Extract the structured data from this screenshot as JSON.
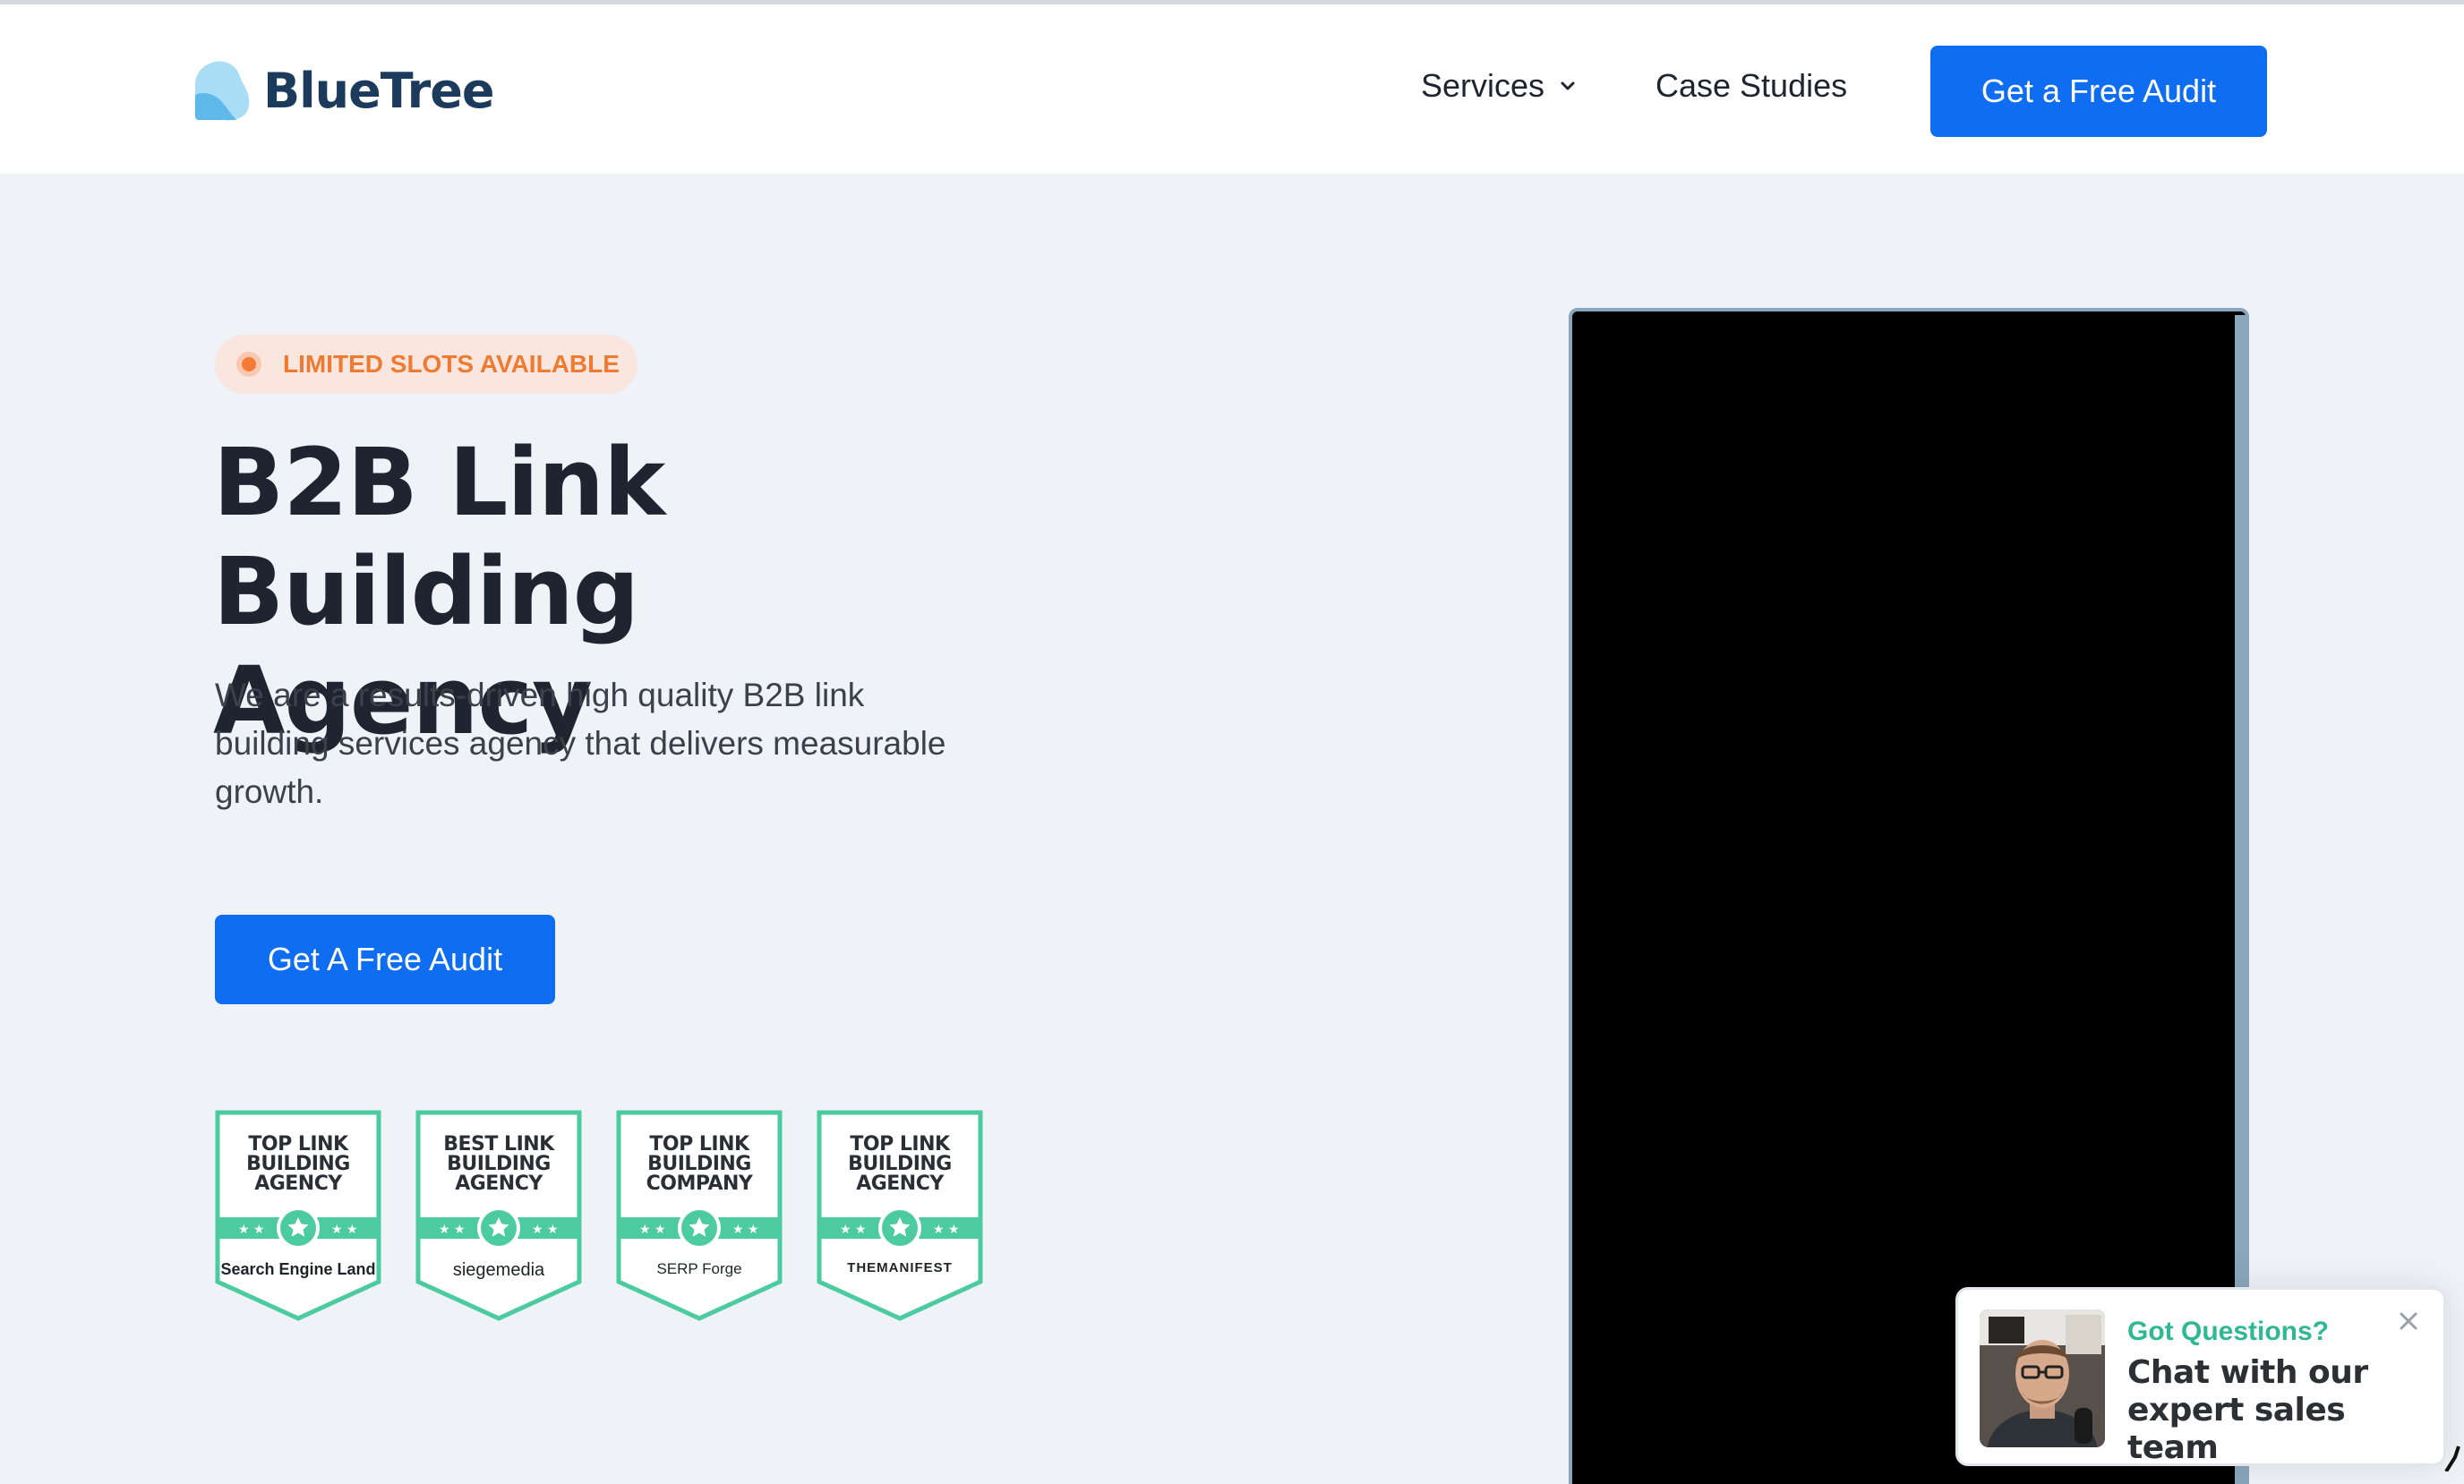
{
  "header": {
    "logo_text": "BlueTree",
    "nav": {
      "services_label": "Services",
      "case_studies_label": "Case Studies"
    },
    "cta_label": "Get a Free Audit"
  },
  "hero": {
    "pill_label": "LIMITED SLOTS AVAILABLE",
    "title_line1": "B2B Link Building",
    "title_line2": "Agency",
    "subtitle": "We are a results-driven high quality B2B link building services agency that delivers measurable growth.",
    "cta_label": "Get A Free Audit"
  },
  "badges": [
    {
      "title": [
        "TOP LINK",
        "BUILDING",
        "AGENCY"
      ],
      "source": "Search Engine Land"
    },
    {
      "title": [
        "BEST LINK",
        "BUILDING",
        "AGENCY"
      ],
      "source": "siegemedia"
    },
    {
      "title": [
        "TOP LINK",
        "BUILDING",
        "COMPANY"
      ],
      "source": "SERP Forge"
    },
    {
      "title": [
        "TOP LINK",
        "BUILDING",
        "AGENCY"
      ],
      "source": "THEMANIFEST"
    }
  ],
  "chat": {
    "question": "Got Questions?",
    "text": "Chat with our expert sales team"
  },
  "colors": {
    "primary": "#0f6df2",
    "badge_green": "#4ccaa0",
    "pill_orange": "#ef7a31",
    "chat_green": "#2fb893",
    "background": "#eff3f8",
    "text_dark": "#1e2530"
  },
  "icons": {
    "services_chevron": "chevron-down-icon",
    "chat_close": "close-icon",
    "badge_star": "star-icon"
  }
}
